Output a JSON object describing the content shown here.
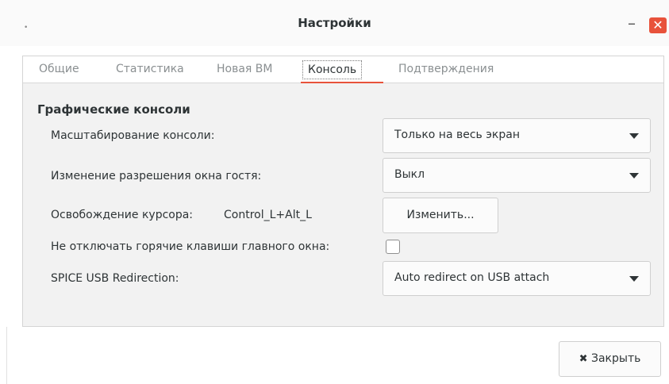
{
  "window": {
    "title": "Настройки",
    "dot": "•",
    "minimize": "–",
    "close": "✕"
  },
  "tabs": [
    {
      "label": "Общие"
    },
    {
      "label": "Статистика"
    },
    {
      "label": "Новая ВМ"
    },
    {
      "label": "Консоль",
      "active": true
    },
    {
      "label": "Подтверждения"
    }
  ],
  "console": {
    "section_title": "Графические консоли",
    "scaling_label": "Масштабирование консоли:",
    "scaling_value": "Только на весь экран",
    "resize_label": "Изменение разрешения окна гостя:",
    "resize_value": "Выкл",
    "grab_label": "Освобождение курсора:",
    "grab_keys": "Control_L+Alt_L",
    "grab_change": "Изменить...",
    "hotkeys_label": "Не отключать горячие клавиши главного окна:",
    "hotkeys_checked": false,
    "usb_label": "SPICE USB Redirection:",
    "usb_value": "Auto redirect on USB attach"
  },
  "footer": {
    "close_icon": "✖",
    "close_label": "Закрыть"
  },
  "colors": {
    "accent": "#e8523b"
  }
}
